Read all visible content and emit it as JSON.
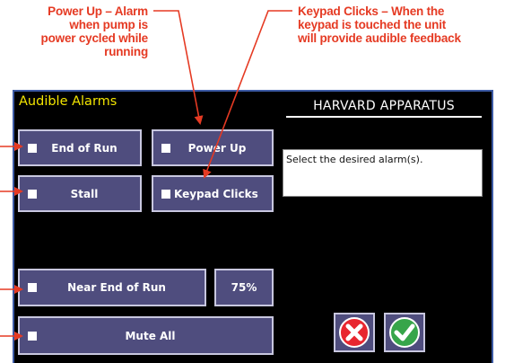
{
  "callouts": {
    "left": {
      "line1": "Power Up – Alarm",
      "line2": "when pump is",
      "line3": "power cycled while",
      "line4": "running"
    },
    "right": {
      "line1": "Keypad Clicks – When the",
      "line2": "keypad is touched the unit",
      "line3": "will provide audible feedback"
    }
  },
  "screen": {
    "title": "Audible Alarms",
    "brand": "HARVARD APPARATUS",
    "message": "Select the desired alarm(s)."
  },
  "alarms": {
    "end_of_run": "End of Run",
    "power_up": "Power Up",
    "stall": "Stall",
    "keypad_clicks": "Keypad Clicks",
    "near_end_of_run": "Near End of Run",
    "near_end_percent": "75%",
    "mute_all": "Mute All"
  },
  "icons": {
    "cancel": "cancel-icon",
    "confirm": "checkmark-icon"
  },
  "colors": {
    "callout": "#e53a23",
    "title": "#f2e400",
    "button": "#4f4d7e",
    "cancel": "#e8262f",
    "confirm": "#37a54a"
  }
}
